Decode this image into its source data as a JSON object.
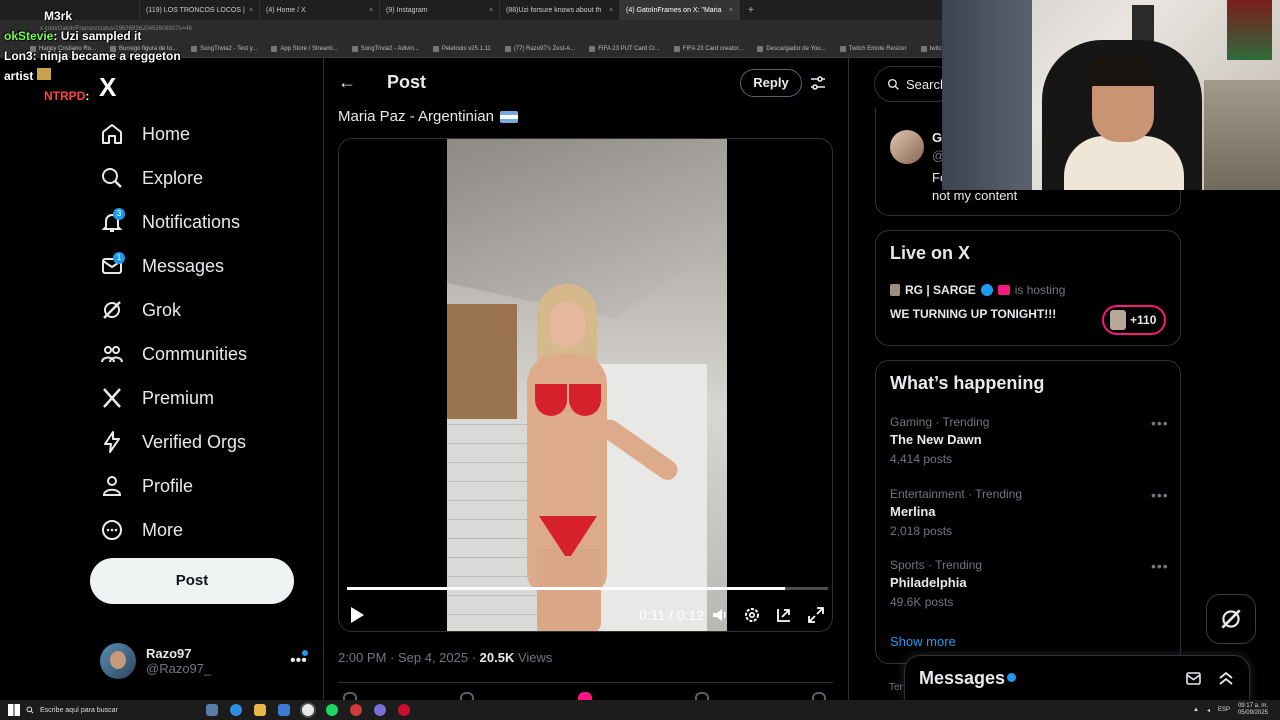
{
  "browser": {
    "tabs": [
      {
        "title": "(119) LOS TRONCOS LOCOS |"
      },
      {
        "title": "(4) Home / X"
      },
      {
        "title": "(9) Instagram"
      },
      {
        "title": "(88)Uzi forsure knows about th"
      },
      {
        "title": "(4) GatoInFrames on X: \"Maria"
      }
    ],
    "url": "x.com/GatoInFrames/status/1963693620453908927s=46",
    "bookmarks": [
      "Happy Cristiano Ro...",
      "Burrego figura de to...",
      "SongTrivia2 - Test y...",
      "App Store / Streami...",
      "SongTrivia2 - Adivin...",
      "Peletools v25.1.11",
      "(77) Razo97's Zest-A...",
      "FIFA 23 PUT Card Cr...",
      "FIFA 23 Card creator...",
      "Descargador de You...",
      "Twitch Emote Resizer",
      "twitch emote resizer..."
    ]
  },
  "chat": [
    {
      "user": "M3rk",
      "msg": "",
      "color": "white"
    },
    {
      "user": "okStevie",
      "msg": ": Uzi sampled it",
      "color": "green"
    },
    {
      "user": "Lon3",
      "msg": ": ninja became a reggeton",
      "color": "white"
    },
    {
      "user": "artist",
      "msg": "",
      "color": "white"
    },
    {
      "user": "NTRPD",
      "msg": ":",
      "color": "red"
    }
  ],
  "sidebar": {
    "logo": "X",
    "items": [
      {
        "label": "Home",
        "icon": "home-icon"
      },
      {
        "label": "Explore",
        "icon": "search-icon"
      },
      {
        "label": "Notifications",
        "icon": "bell-icon",
        "badge": "3"
      },
      {
        "label": "Messages",
        "icon": "mail-icon",
        "badge": "1"
      },
      {
        "label": "Grok",
        "icon": "grok-icon"
      },
      {
        "label": "Communities",
        "icon": "communities-icon"
      },
      {
        "label": "Premium",
        "icon": "x-premium-icon"
      },
      {
        "label": "Verified Orgs",
        "icon": "lightning-icon"
      },
      {
        "label": "Profile",
        "icon": "person-icon"
      },
      {
        "label": "More",
        "icon": "more-circle-icon"
      }
    ],
    "post_button": "Post",
    "profile": {
      "name": "Razo97",
      "handle": "@Razo97_"
    }
  },
  "post": {
    "header": "Post",
    "reply_button": "Reply",
    "text": "Maria Paz - Argentinian",
    "video": {
      "time": "0:11 / 0:12",
      "progress": 0.91
    },
    "timestamp": "2:00 PM · Sep 4, 2025 · ",
    "views_count": "20.5K",
    "views_label": " Views"
  },
  "right": {
    "search_placeholder": "Search",
    "card1": {
      "name": "G",
      "handle": "@",
      "text1": "Fe",
      "text2": "not my content"
    },
    "live": {
      "title": "Live on X",
      "host": "RG | SARGE",
      "hosting": "is hosting",
      "stream_title": "WE TURNING UP TONIGHT!!!",
      "listeners": "+110"
    },
    "happening": {
      "title": "What’s happening",
      "trends": [
        {
          "category": "Gaming · Trending",
          "name": "The New Dawn",
          "count": "4,414 posts"
        },
        {
          "category": "Entertainment · Trending",
          "name": "Merlina",
          "count": "2,018 posts"
        },
        {
          "category": "Sports · Trending",
          "name": "Philadelphia",
          "count": "49.6K posts"
        }
      ],
      "show_more": "Show more"
    },
    "terms_stub": "Ter",
    "messages_dock": "Messages"
  },
  "taskbar": {
    "search_placeholder": "Escribe aquí para buscar",
    "lang": "ESP",
    "time": "09:17 a. m.",
    "date": "05/09/2025"
  }
}
